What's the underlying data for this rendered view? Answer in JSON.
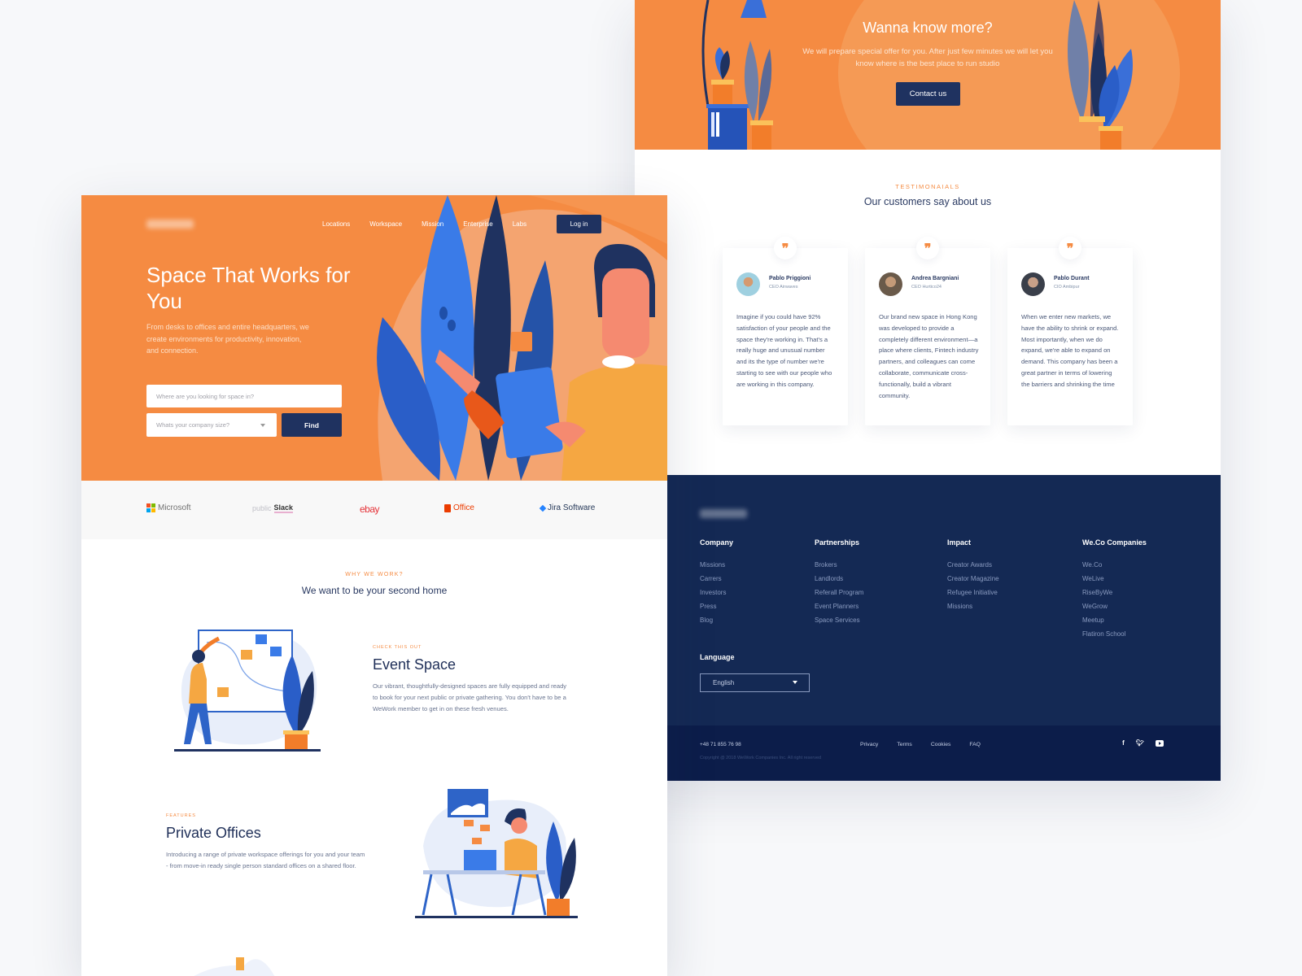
{
  "cta": {
    "title": "Wanna know more?",
    "text": "We will prepare special offer for you. After just few minutes we will let you know where is the  best place to run studio",
    "button": "Contact us"
  },
  "testimonials": {
    "eyebrow": "TESTIMONAIALS",
    "title": "Our customers say about us",
    "quote_icon": "quote-icon",
    "cards": [
      {
        "name": "Pablo Priggioni",
        "role": "CEO Airwaves",
        "text": "Imagine if you could have 92% satisfaction of your people and the space they're working in. That's a really huge and unusual number and its the type of number we're starting to see with our people who are working in this company."
      },
      {
        "name": "Andrea Bargniani",
        "role": "CEO Hurtico24",
        "text": "Our brand new space in Hong Kong was developed to provide a completely different environment—a place where clients, Fintech industry partners, and colleagues can come collaborate, communicate cross-functionally, build a vibrant community."
      },
      {
        "name": "Pablo Durant",
        "role": "CIO Ambipur",
        "text": "When we enter new markets, we have the ability to shrink or expand. Most importantly, when we do expand, we're able to expand on demand. This company has been a great partner in terms of lowering the barriers and shrinking the time"
      }
    ]
  },
  "footer": {
    "columns": [
      {
        "heading": "Company",
        "links": [
          "Missions",
          "Carrers",
          "Investors",
          "Press",
          "Blog"
        ]
      },
      {
        "heading": "Partnerships",
        "links": [
          "Brokers",
          "Landlords",
          "Referall Program",
          "Event Planners",
          "Space Services"
        ]
      },
      {
        "heading": "Impact",
        "links": [
          "Creator Awards",
          "Creator Magazine",
          "Refugee Initiative",
          "Missions"
        ]
      },
      {
        "heading": "We.Co Companies",
        "links": [
          "We.Co",
          "WeLive",
          "RiseByWe",
          "WeGrow",
          "Meetup",
          "Flatiron School"
        ]
      }
    ],
    "language_label": "Language",
    "language_value": "English",
    "phone": "+48 71 855 76 98",
    "copyright": "Copyright @ 2018 WeWork Companies Inc. All right reserved",
    "bottom_links": [
      "Privacy",
      "Terms",
      "Cookies",
      "FAQ"
    ],
    "social": [
      "facebook-icon",
      "twitter-icon",
      "youtube-icon"
    ]
  },
  "hero": {
    "nav": [
      "Locations",
      "Workspace",
      "Mission",
      "Enterprise",
      "Labs"
    ],
    "login": "Log in",
    "title": "Space That Works for You",
    "subtitle": "From desks to offices and entire headquarters, we create environments for productivity, innovation, and connection.",
    "search_placeholder": "Where are you looking for space in?",
    "size_placeholder": "Whats your company size?",
    "find": "Find"
  },
  "logos": [
    "Microsoft",
    "Slack",
    "ebay",
    "Office",
    "Jira Software"
  ],
  "logos_prefix_slack": "public",
  "why": {
    "eyebrow": "WHY WE WORK?",
    "title": "We want to be your second home"
  },
  "features": [
    {
      "eyebrow": "CHECK THIS OUT",
      "title": "Event Space",
      "text": "Our vibrant, thoughtfully-designed spaces are fully equipped and ready to book for your next public or private gathering. You don't have to be a WeWork member to get in on these fresh venues."
    },
    {
      "eyebrow": "FEATURES",
      "title": "Private Offices",
      "text": "Introducing a range of private workspace offerings for you and your team - from move-in ready single person standard offices on a shared floor."
    }
  ],
  "colors": {
    "accent": "#f58b42",
    "navy": "#1f3260",
    "footer": "#142954",
    "footer_bottom": "#0c1d4a"
  }
}
